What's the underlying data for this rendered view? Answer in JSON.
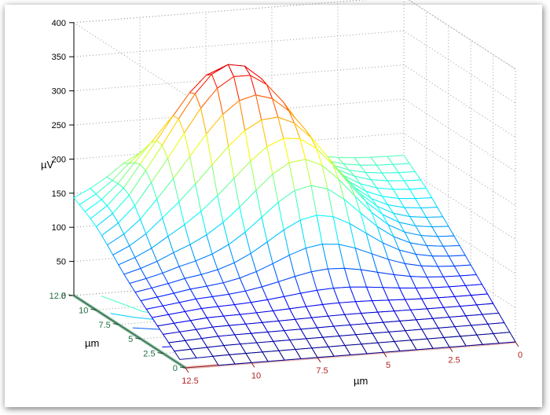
{
  "chart_data": {
    "type": "surface",
    "title": "",
    "zlabel": "µV",
    "xlabel": "µm",
    "ylabel": "µm",
    "zlim": [
      0,
      400
    ],
    "xlim": [
      0,
      12.5
    ],
    "ylim": [
      0,
      12.5
    ],
    "z_ticks": [
      "0",
      "50",
      "100",
      "150",
      "200",
      "250",
      "300",
      "350",
      "400"
    ],
    "x_ticks": [
      "12.5",
      "10",
      "7.5",
      "5",
      "2.5",
      "0"
    ],
    "y_ticks": [
      "0",
      "2.5",
      "5",
      "7.5",
      "10",
      "12.5"
    ],
    "grid": true,
    "colormap": "jet",
    "contour_projection": true,
    "surface": {
      "x": [
        0,
        1.25,
        2.5,
        3.75,
        5,
        6.25,
        7.5,
        8.75,
        10,
        11.25,
        12.5
      ],
      "y": [
        0,
        1.25,
        2.5,
        3.75,
        5,
        6.25,
        7.5,
        8.75,
        10,
        11.25,
        12.5
      ],
      "peak": {
        "x": 7.5,
        "y": 10,
        "z": 365
      },
      "secondary_peak": {
        "x": 5.5,
        "y": 7,
        "z": 305
      },
      "edge_y0_z": 0,
      "edge_x12_5_z_range": [
        60,
        165
      ]
    },
    "axis_colors": {
      "x": "#e08a8a",
      "y": "#2e8b57"
    },
    "label_colors": {
      "x": "#b22222",
      "y": "#1f6f3f",
      "z": "#000000"
    }
  }
}
